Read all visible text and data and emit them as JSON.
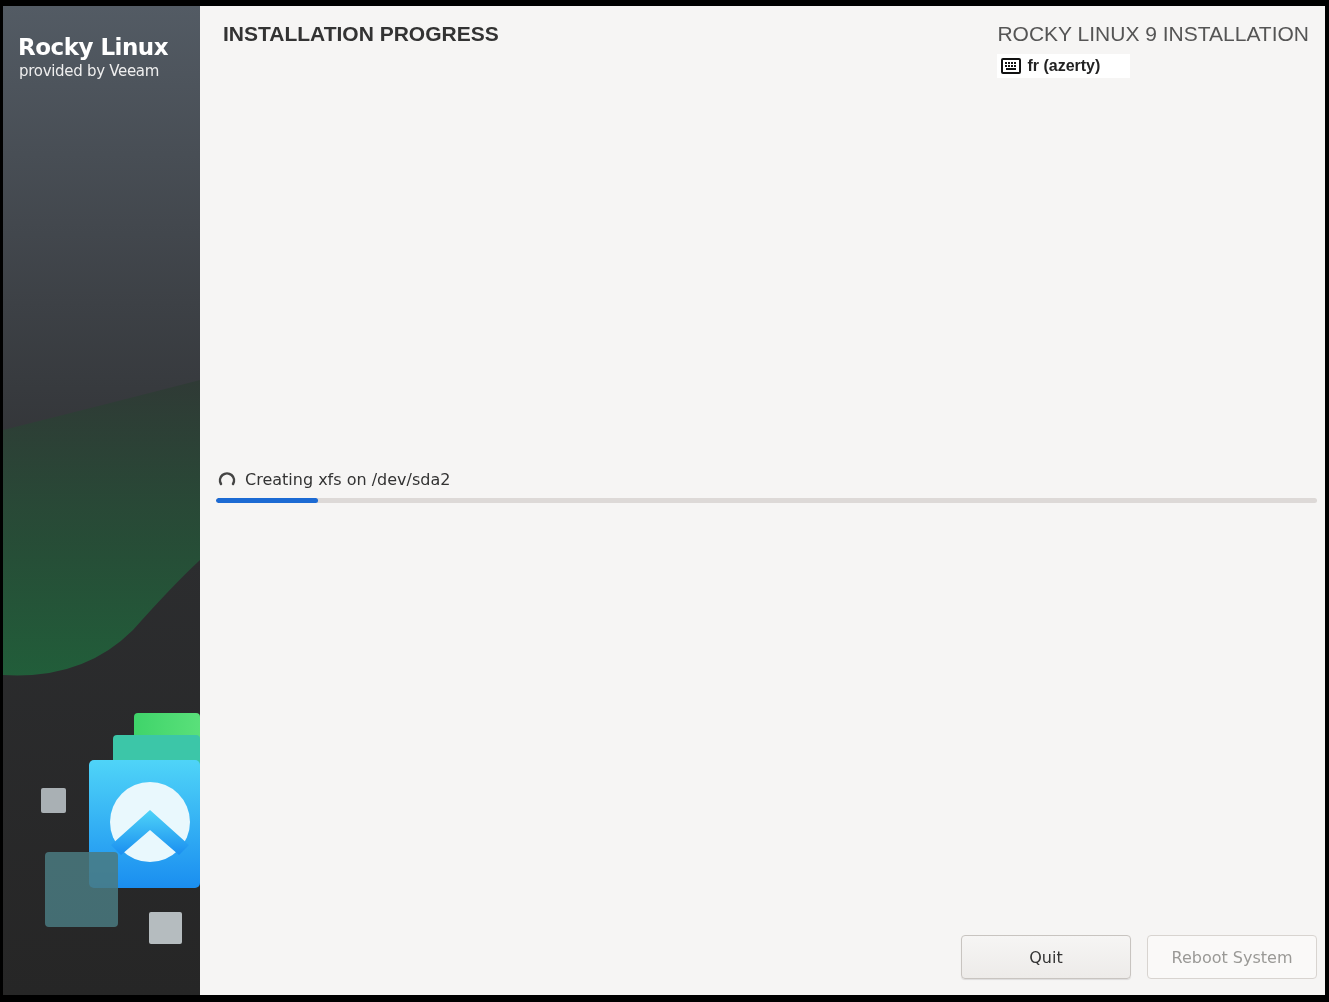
{
  "sidebar": {
    "brand": "Rocky Linux",
    "subtitle": "provided by Veeam"
  },
  "header": {
    "title": "INSTALLATION PROGRESS",
    "product": "ROCKY LINUX 9 INSTALLATION",
    "keyboard": "fr (azerty)"
  },
  "progress": {
    "status": "Creating xfs on /dev/sda2",
    "level": 0.093
  },
  "buttons": [
    {
      "label": "Quit",
      "disabled": false
    },
    {
      "label": "Reboot System",
      "disabled": true
    }
  ]
}
